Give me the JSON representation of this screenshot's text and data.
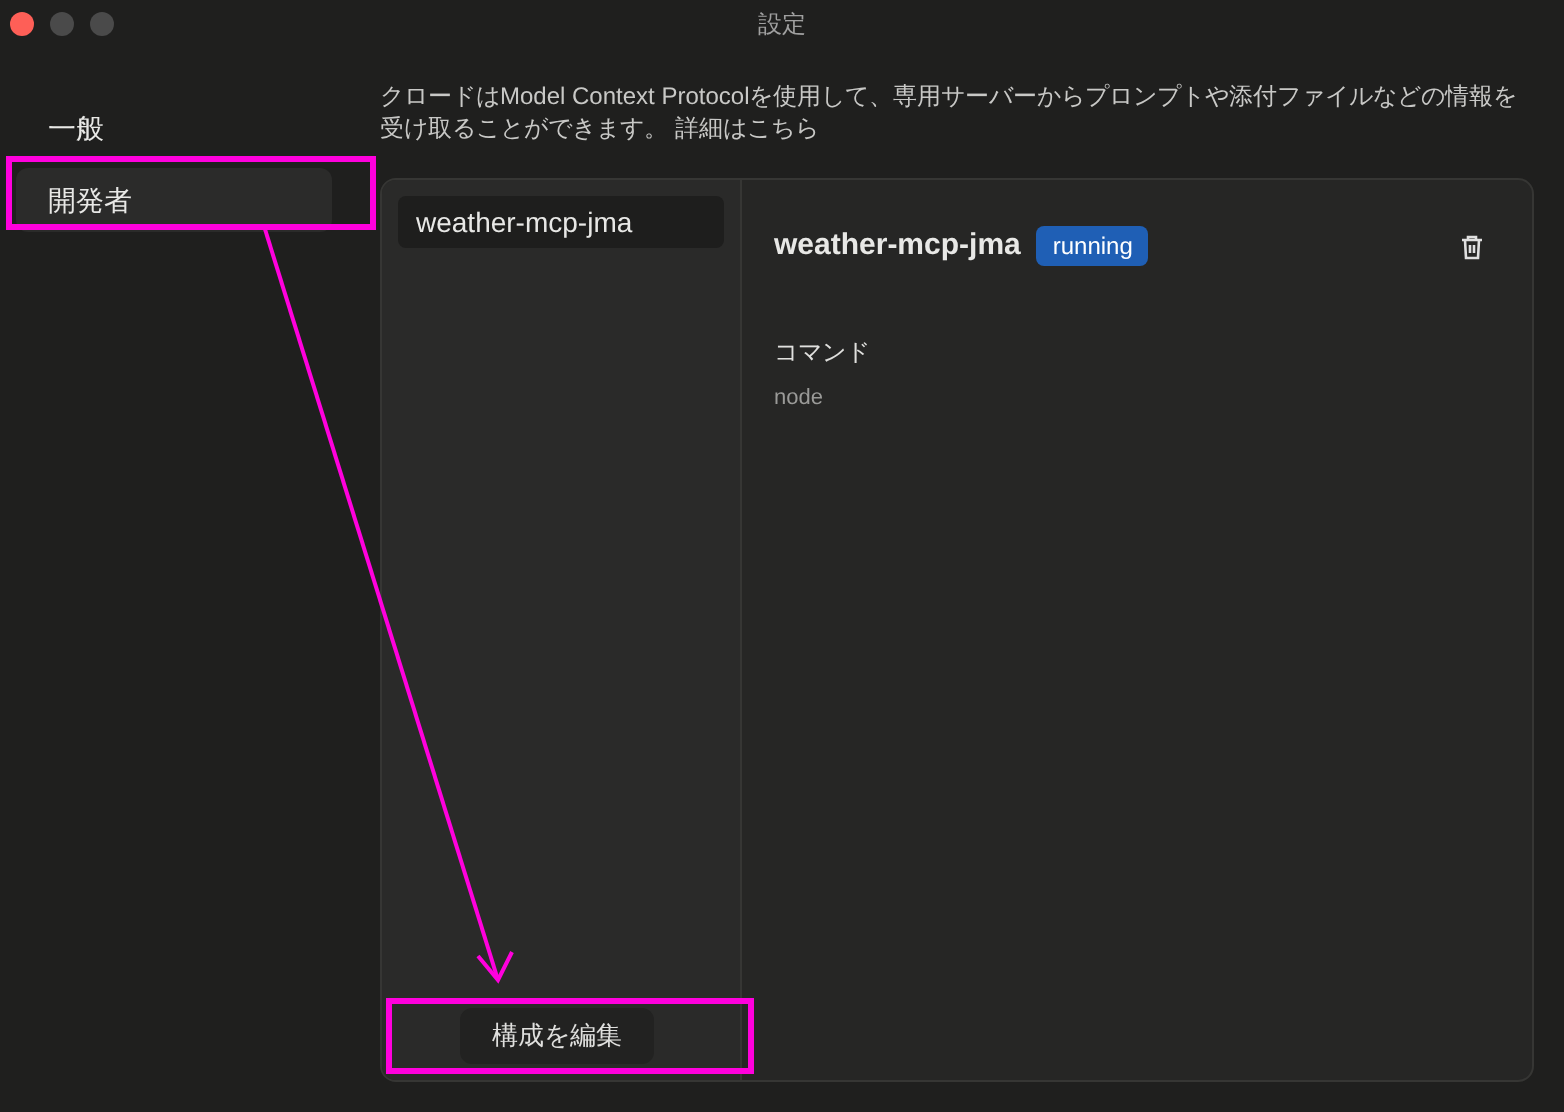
{
  "window": {
    "title": "設定"
  },
  "sidebar": {
    "items": [
      {
        "label": "一般",
        "selected": false
      },
      {
        "label": "開発者",
        "selected": true
      }
    ]
  },
  "description": "クロードはModel Context Protocolを使用して、専用サーバーからプロンプトや添付ファイルなどの情報を受け取ることができます。 詳細はこちら",
  "servers": [
    {
      "name": "weather-mcp-jma",
      "selected": true
    }
  ],
  "detail": {
    "name": "weather-mcp-jma",
    "status": "running",
    "command_label": "コマンド",
    "command": "node"
  },
  "edit_button": "構成を編集",
  "annotations": [
    {
      "kind": "box",
      "color": "#ff00dd"
    },
    {
      "kind": "box",
      "color": "#ff00dd"
    },
    {
      "kind": "arrow",
      "color": "#ff00dd"
    }
  ]
}
